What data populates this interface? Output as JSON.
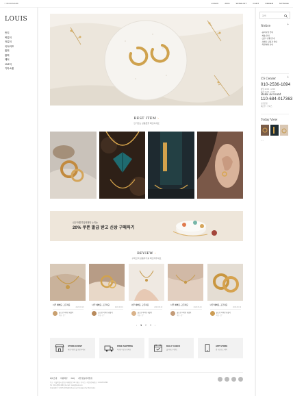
{
  "header": {
    "bookmark": "☆ BOOKMARK",
    "nav": [
      "LOGIN",
      "JOIN",
      "WISHLIST",
      "CART",
      "ORDER",
      "MYPAGE"
    ]
  },
  "left": {
    "logo": "LOUIS",
    "categories": [
      "반지",
      "목걸이",
      "귀걸이",
      "이어커프",
      "팔찌",
      "발찌",
      "헤어",
      "브로치",
      "기타소품"
    ]
  },
  "best": {
    "title": "BEST ITEM",
    "subtitle": "인기있는 상품들을 확인하세요"
  },
  "banner": {
    "small": "신규 회원가입에게만 누리는",
    "big": "20% 쿠폰 발급 받고 신상 구매하기"
  },
  "review": {
    "title": "REVIEW",
    "subtitle": "구매고객 상품후기를 확인해주세요",
    "cards": [
      {
        "title": "너무 예뻐요, 고급져요",
        "date": "2023.06.19",
        "name": "골드링 이어링 귀걸이",
        "meta": "작성 : 김**"
      },
      {
        "title": "너무 예뻐요, 고급져요",
        "date": "2023.06.19",
        "name": "골드링 이어링 귀걸이",
        "meta": "작성 : 김**"
      },
      {
        "title": "너무 예뻐요, 고급져요",
        "date": "2023.06.19",
        "name": "골드링 이어링 귀걸이",
        "meta": "작성 : 김**"
      },
      {
        "title": "너무 예뻐요, 고급져요",
        "date": "2023.06.19",
        "name": "골드링 이어링 귀걸이",
        "meta": "작성 : 김**"
      },
      {
        "title": "너무 예뻐요, 고급져요",
        "date": "2023.06.19",
        "name": "골드링 이어링 귀걸이",
        "meta": "작성 : 김**"
      }
    ]
  },
  "pager": {
    "prev": "‹",
    "pages": [
      "1",
      "2",
      "3"
    ],
    "current": "1",
    "next": "›"
  },
  "services": [
    {
      "icon": "store-icon",
      "title": "STORE EVENT",
      "desc": "매장 이벤트를 확인하세요"
    },
    {
      "icon": "truck-icon",
      "title": "FREE SHIPPING",
      "desc": "5만원 이상 무료배송"
    },
    {
      "icon": "calendar-icon",
      "title": "DAILY CHECK",
      "desc": "출석체크 이벤트"
    },
    {
      "icon": "phone-icon",
      "title": "APP STORE",
      "desc": "앱 다운로드 혜택"
    }
  ],
  "footer": {
    "links": [
      "회사소개",
      "이용약관",
      "FAQ",
      "개인정보처리방침"
    ],
    "info1": "주소 : 서울특별시 강남구 테헤란로 123 | 대표 : 루이스 | 사업자등록번호 : 123-45-67890",
    "info2": "Tel : 010-2536-1894 | E-mail : louis@louis.com",
    "info3": "Copyright © LOUIS All Rights Reserved. Designed by Webmaker."
  },
  "right": {
    "search_placeholder": "검색",
    "notice_title": "Notice",
    "notices": [
      "- 공지사항 안내",
      "- 배송 안내",
      "- 교환 / 반품 안내",
      "- 이벤트 당첨자 안내",
      "- 회원혜택 안내"
    ],
    "cs_title": "CS Center",
    "phone": "010-2536-1894",
    "hours1": "평일 10:00 - 18:00",
    "hours2": "점심 12:00 - 13:00",
    "bank_title": "Bank Account",
    "account": "110-684-017363",
    "bank": "신한은행",
    "holder": "예금주 : 루이스",
    "today_title": "Today View",
    "today_nav": "‹ ›"
  },
  "colors": {
    "accent": "#e8a14a",
    "banner_bg": "#eee6da",
    "page_bg": "#f4f4f4"
  }
}
